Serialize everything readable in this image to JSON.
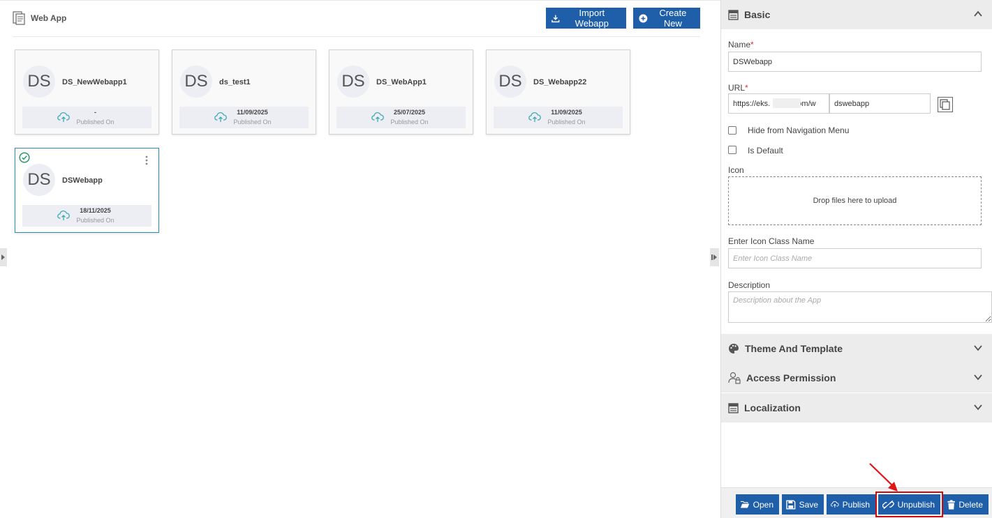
{
  "header": {
    "title": "Web App",
    "import_label": "Import Webapp",
    "create_label": "Create New"
  },
  "cards": [
    {
      "initials": "DS",
      "name": "DS_NewWebapp1",
      "date": "-",
      "published_label": "Published On"
    },
    {
      "initials": "DS",
      "name": "ds_test1",
      "date": "11/09/2025",
      "published_label": "Published On"
    },
    {
      "initials": "DS",
      "name": "DS_WebApp1",
      "date": "25/07/2025",
      "published_label": "Published On"
    },
    {
      "initials": "DS",
      "name": "DS_Webapp22",
      "date": "11/09/2025",
      "published_label": "Published On"
    },
    {
      "initials": "DS",
      "name": "DSWebapp",
      "date": "18/11/2025",
      "published_label": "Published On",
      "selected": true
    }
  ],
  "panel": {
    "basic": {
      "title": "Basic",
      "name_label": "Name",
      "name_value": "DSWebapp",
      "url_label": "URL",
      "url_prefix": "https://eks.          .com/w",
      "url_suffix": "dswebapp",
      "hide_nav_label": "Hide from Navigation Menu",
      "is_default_label": "Is Default",
      "icon_label": "Icon",
      "drop_text": "Drop files here to upload",
      "icon_class_label": "Enter Icon Class Name",
      "icon_class_placeholder": "Enter Icon Class Name",
      "description_label": "Description",
      "description_placeholder": "Description about the App",
      "required_mark": "*"
    },
    "theme_title": "Theme And Template",
    "access_title": "Access Permission",
    "localization_title": "Localization"
  },
  "footer": {
    "open": "Open",
    "save": "Save",
    "publish": "Publish",
    "unpublish": "Unpublish",
    "delete": "Delete"
  },
  "colors": {
    "primary": "#1f5faa",
    "selected_border": "#2b8fb3",
    "success": "#2a9a6a",
    "highlight": "#d10a0a"
  }
}
